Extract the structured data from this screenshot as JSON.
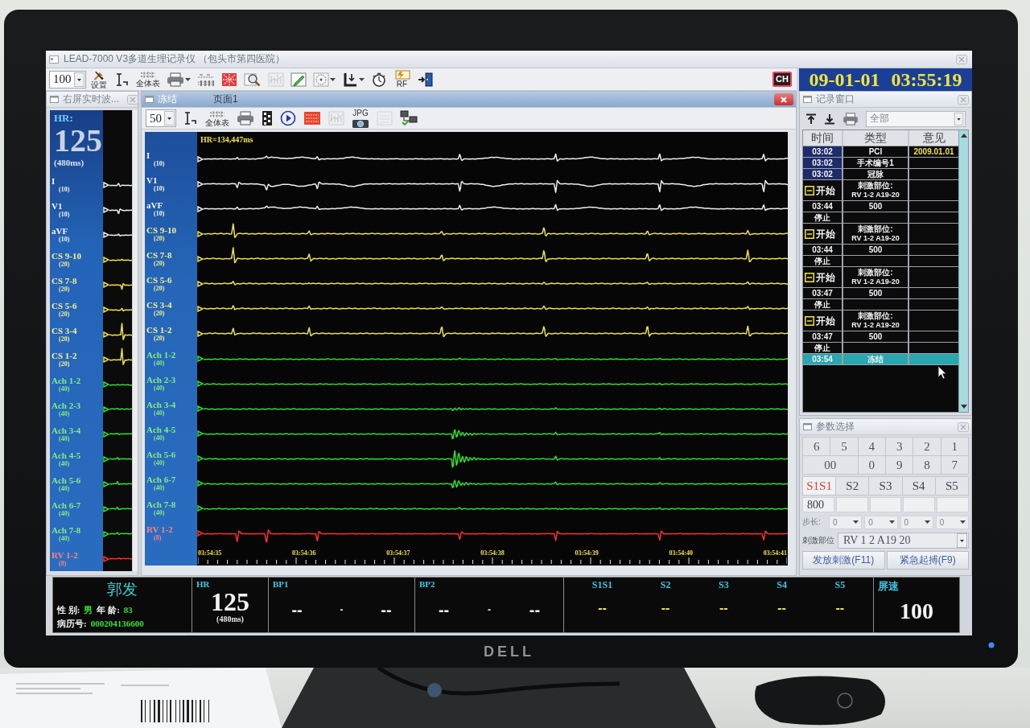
{
  "window": {
    "title": "LEAD-7000 V3多道生理记录仪 （包头市第四医院）"
  },
  "toolbar": {
    "speed": "100",
    "tools": [
      {
        "kind": "tools",
        "label": "设置",
        "menu": false,
        "disabled": false
      },
      {
        "kind": "calibrate",
        "menu": false,
        "disabled": false
      },
      {
        "kind": "table",
        "label": "全体表",
        "menu": false,
        "disabled": false
      },
      {
        "kind": "printer",
        "menu": true,
        "disabled": false
      },
      {
        "kind": "grid",
        "menu": false,
        "disabled": false
      },
      {
        "kind": "pattern",
        "menu": false,
        "disabled": false
      },
      {
        "kind": "magnifier",
        "menu": false,
        "disabled": false
      },
      {
        "kind": "ruler",
        "menu": false,
        "disabled": true
      },
      {
        "kind": "pencil",
        "menu": false,
        "disabled": false
      },
      {
        "kind": "target",
        "menu": true,
        "disabled": false
      },
      {
        "kind": "marker",
        "menu": true,
        "disabled": false
      },
      {
        "kind": "stopwatch",
        "menu": false,
        "disabled": false
      },
      {
        "kind": "rf",
        "label": "RF",
        "menu": false,
        "disabled": false
      },
      {
        "kind": "exit",
        "menu": false,
        "disabled": false
      }
    ],
    "badge": "CH"
  },
  "clock": {
    "date": "09-01-01",
    "time": "03:55:19"
  },
  "live_panel": {
    "title": "右屏实时波...",
    "hr_label": "HR:",
    "hr_value": "125",
    "hr_interval": "(480ms)",
    "channels": [
      {
        "name": "I",
        "gain": "(10)",
        "kind": "ecg",
        "color": "#f0f0f0"
      },
      {
        "name": "V1",
        "gain": "(10)",
        "kind": "ecg",
        "color": "#f0f0f0"
      },
      {
        "name": "aVF",
        "gain": "(10)",
        "kind": "ecg",
        "color": "#f0f0f0"
      },
      {
        "name": "CS 9-10",
        "gain": "(20)",
        "kind": "cs",
        "color": "#f2e24a"
      },
      {
        "name": "CS 7-8",
        "gain": "(20)",
        "kind": "cs",
        "color": "#f2e24a"
      },
      {
        "name": "CS 5-6",
        "gain": "(20)",
        "kind": "cs",
        "color": "#f2e24a"
      },
      {
        "name": "CS 3-4",
        "gain": "(20)",
        "kind": "cs",
        "color": "#f2e24a"
      },
      {
        "name": "CS 1-2",
        "gain": "(20)",
        "kind": "cs",
        "color": "#f2e24a"
      },
      {
        "name": "Ach 1-2",
        "gain": "(40)",
        "kind": "ach",
        "color": "#2fe02f"
      },
      {
        "name": "Ach 2-3",
        "gain": "(40)",
        "kind": "ach",
        "color": "#2fe02f"
      },
      {
        "name": "Ach 3-4",
        "gain": "(40)",
        "kind": "ach",
        "color": "#2fe02f"
      },
      {
        "name": "Ach 4-5",
        "gain": "(40)",
        "kind": "ach",
        "color": "#2fe02f"
      },
      {
        "name": "Ach 5-6",
        "gain": "(40)",
        "kind": "ach",
        "color": "#2fe02f"
      },
      {
        "name": "Ach 6-7",
        "gain": "(40)",
        "kind": "ach",
        "color": "#2fe02f"
      },
      {
        "name": "Ach 7-8",
        "gain": "(40)",
        "kind": "ach",
        "color": "#2fe02f"
      },
      {
        "name": "RV 1-2",
        "gain": "(8)",
        "kind": "rv",
        "color": "#ff2e2e"
      }
    ]
  },
  "main_panel": {
    "title": "冻结",
    "page": "页面1",
    "speed": "50",
    "tools": [
      {
        "kind": "calibrate",
        "menu": false,
        "disabled": false
      },
      {
        "kind": "table",
        "label": "全体表",
        "menu": false,
        "disabled": false
      },
      {
        "kind": "printer",
        "menu": false,
        "disabled": false
      },
      {
        "kind": "film",
        "menu": false,
        "disabled": false
      },
      {
        "kind": "play",
        "menu": false,
        "disabled": false
      },
      {
        "kind": "stimulus",
        "menu": false,
        "disabled": false
      },
      {
        "kind": "ruler",
        "menu": false,
        "disabled": true
      },
      {
        "kind": "camera",
        "label": "JPG",
        "menu": false,
        "disabled": false
      },
      {
        "kind": "document",
        "menu": false,
        "disabled": true
      },
      {
        "kind": "network",
        "menu": false,
        "disabled": false
      }
    ],
    "hr_readout": "HR=134,447ms",
    "channels": [
      {
        "name": "I",
        "gain": "(10)",
        "kind": "ecg",
        "color": "#f0f0f0"
      },
      {
        "name": "V1",
        "gain": "(10)",
        "kind": "ecg",
        "color": "#f0f0f0"
      },
      {
        "name": "aVF",
        "gain": "(10)",
        "kind": "ecg",
        "color": "#f0f0f0"
      },
      {
        "name": "CS 9-10",
        "gain": "(20)",
        "kind": "cs",
        "color": "#f2e24a"
      },
      {
        "name": "CS 7-8",
        "gain": "(20)",
        "kind": "cs",
        "color": "#f2e24a"
      },
      {
        "name": "CS 5-6",
        "gain": "(20)",
        "kind": "cs",
        "color": "#f2e24a"
      },
      {
        "name": "CS 3-4",
        "gain": "(20)",
        "kind": "cs",
        "color": "#f2e24a"
      },
      {
        "name": "CS 1-2",
        "gain": "(20)",
        "kind": "cs",
        "color": "#f2e24a"
      },
      {
        "name": "Ach 1-2",
        "gain": "(40)",
        "kind": "ach",
        "color": "#2fe02f"
      },
      {
        "name": "Ach 2-3",
        "gain": "(40)",
        "kind": "ach",
        "color": "#2fe02f"
      },
      {
        "name": "Ach 3-4",
        "gain": "(40)",
        "kind": "ach",
        "color": "#2fe02f"
      },
      {
        "name": "Ach 4-5",
        "gain": "(40)",
        "kind": "ach",
        "color": "#2fe02f"
      },
      {
        "name": "Ach 5-6",
        "gain": "(40)",
        "kind": "ach",
        "color": "#2fe02f"
      },
      {
        "name": "Ach 6-7",
        "gain": "(40)",
        "kind": "ach",
        "color": "#2fe02f"
      },
      {
        "name": "Ach 7-8",
        "gain": "(40)",
        "kind": "ach",
        "color": "#2fe02f"
      },
      {
        "name": "RV 1-2",
        "gain": "(8)",
        "kind": "rv",
        "color": "#ff2e2e"
      }
    ],
    "time_labels": [
      "03:54:35",
      "03:54:36",
      "03:54:37",
      "03:54:38",
      "03:54:39",
      "03:54:40",
      "03:54:41"
    ]
  },
  "record_window": {
    "title": "记录窗口",
    "filter": "全部",
    "columns": [
      "时间",
      "类型",
      "意见"
    ],
    "rows": [
      {
        "kind": "note",
        "time": "03:02",
        "type": "PCI",
        "remark": "2009.01.01",
        "selected": false
      },
      {
        "kind": "note",
        "time": "03:02",
        "type": "手术编号1",
        "selected": false
      },
      {
        "kind": "note",
        "time": "03:02",
        "type": "冠脉",
        "selected": false
      },
      {
        "kind": "group",
        "time": "开始",
        "type": "刺激部位:",
        "site": "RV 1-2 A19-20",
        "expanded": true,
        "selected": false,
        "children": [
          {
            "kind": "event",
            "time": "03:44",
            "type": "500",
            "selected": false
          },
          {
            "kind": "event",
            "time": "停止",
            "selected": false
          }
        ]
      },
      {
        "kind": "group",
        "time": "开始",
        "type": "刺激部位:",
        "site": "RV 1-2 A19-20",
        "expanded": true,
        "selected": false,
        "children": [
          {
            "kind": "event",
            "time": "03:44",
            "type": "500",
            "selected": false
          },
          {
            "kind": "event",
            "time": "停止",
            "selected": false
          }
        ]
      },
      {
        "kind": "group",
        "time": "开始",
        "type": "刺激部位:",
        "site": "RV 1-2 A19-20",
        "expanded": true,
        "selected": false,
        "children": [
          {
            "kind": "event",
            "time": "03:47",
            "type": "500",
            "selected": false
          },
          {
            "kind": "event",
            "time": "停止",
            "selected": false
          }
        ]
      },
      {
        "kind": "group",
        "time": "开始",
        "type": "刺激部位:",
        "site": "RV 1-2 A19-20",
        "expanded": true,
        "selected": false,
        "children": [
          {
            "kind": "event",
            "time": "03:47",
            "type": "500",
            "selected": false
          },
          {
            "kind": "event",
            "time": "停止",
            "selected": false
          }
        ]
      },
      {
        "kind": "event",
        "time": "03:54",
        "type": "冻结",
        "selected": true
      }
    ]
  },
  "parameters": {
    "title": "参数选择",
    "keypad": [
      [
        "6",
        "5",
        "4",
        "3",
        "2",
        "1"
      ],
      [
        "00",
        "0",
        "9",
        "8",
        "7"
      ]
    ],
    "modes": [
      {
        "label": "S1S1",
        "selected": true,
        "value": "800"
      },
      {
        "label": "S2",
        "selected": false
      },
      {
        "label": "S3",
        "selected": false
      },
      {
        "label": "S4",
        "selected": false
      },
      {
        "label": "S5",
        "selected": false
      }
    ],
    "step": {
      "label": "步长:",
      "disabled": true,
      "values": [
        "0",
        "0",
        "0",
        "0"
      ]
    },
    "site": {
      "label": "刺激部位",
      "value": "RV 1 2 A19 20"
    },
    "buttons": [
      "发放刺激(F11)",
      "紧急起搏(F9)"
    ]
  },
  "status_bar": {
    "patient": {
      "name": "郭发",
      "fields": [
        {
          "label": "性 别:",
          "value": "男"
        },
        {
          "label": "年 龄:",
          "value": "83"
        }
      ],
      "record_label": "病历号:",
      "record_no": "000204136600"
    },
    "hr": {
      "label": "HR",
      "value": "125",
      "interval": "(480ms)"
    },
    "bp": [
      {
        "label": "BP1",
        "systolic": "--",
        "separator": "-",
        "diastolic": "--"
      },
      {
        "label": "BP2",
        "systolic": "--",
        "separator": "-",
        "diastolic": "--"
      }
    ],
    "stim": [
      {
        "label": "S1S1",
        "value": "--"
      },
      {
        "label": "S2",
        "value": "--"
      },
      {
        "label": "S3",
        "value": "--"
      },
      {
        "label": "S4",
        "value": "--"
      },
      {
        "label": "S5",
        "value": "--"
      }
    ],
    "speed": {
      "label": "屏速",
      "value": "100"
    }
  },
  "monitor": {
    "logo": "DELL"
  }
}
